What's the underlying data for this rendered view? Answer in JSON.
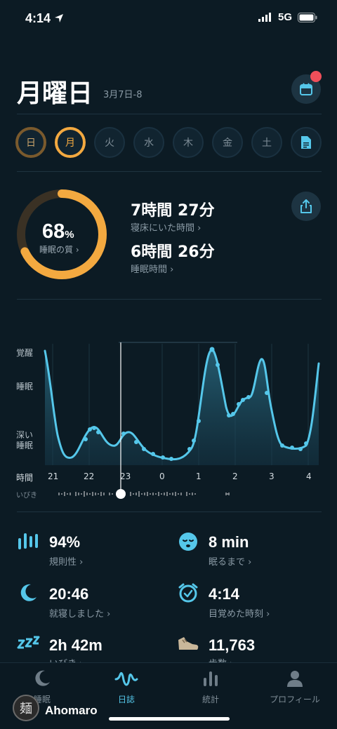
{
  "status": {
    "time": "4:14",
    "network": "5G"
  },
  "header": {
    "title": "月曜日",
    "date_range": "3月7日-8"
  },
  "days": [
    {
      "label": "日",
      "state": "done"
    },
    {
      "label": "月",
      "state": "active"
    },
    {
      "label": "火",
      "state": "none"
    },
    {
      "label": "水",
      "state": "none"
    },
    {
      "label": "木",
      "state": "none"
    },
    {
      "label": "金",
      "state": "none"
    },
    {
      "label": "土",
      "state": "none"
    }
  ],
  "summary": {
    "quality_pct": "68",
    "quality_pct_unit": "%",
    "quality_value": 0.68,
    "quality_label": "睡眠の質 ›",
    "time_in_bed": "7時間 27分",
    "time_in_bed_label": "寝床にいた時間 ›",
    "sleep_time": "6時間 26分",
    "sleep_time_label": "睡眠時間 ›"
  },
  "chart": {
    "y_labels": {
      "awake": "覚醒",
      "sleep": "睡眠",
      "deep_1": "深い",
      "deep_2": "睡眠"
    },
    "x_title": "時間",
    "x_ticks": [
      "21",
      "22",
      "23",
      "0",
      "1",
      "2",
      "3",
      "4"
    ],
    "snore_label": "いびき"
  },
  "metrics": [
    {
      "value": "94%",
      "label": "規則性 ›",
      "icon": "regularity-bars-icon"
    },
    {
      "value": "8 min",
      "label": "眠るまで ›",
      "icon": "sleepy-face-icon"
    },
    {
      "value": "20:46",
      "label": "就寝しました ›",
      "icon": "moon-icon"
    },
    {
      "value": "4:14",
      "label": "目覚めた時刻 ›",
      "icon": "alarm-clock-icon"
    },
    {
      "value": "2h 42m",
      "label": "いびき ›",
      "icon": "snore-zzz-icon"
    },
    {
      "value": "11,763",
      "label": "歩数 ›",
      "icon": "shoe-icon"
    }
  ],
  "tabs": [
    {
      "label": "睡眠",
      "icon": "moon-icon",
      "active": false
    },
    {
      "label": "日誌",
      "icon": "waveform-icon",
      "active": true
    },
    {
      "label": "統計",
      "icon": "bar-chart-icon",
      "active": false
    },
    {
      "label": "プロフィール",
      "icon": "person-icon",
      "active": false
    }
  ],
  "user": {
    "name": "Ahomaro",
    "avatar_glyph": "麺"
  },
  "colors": {
    "accent": "#55c7ea",
    "quality": "#f3a940",
    "background": "#0c1b24"
  }
}
